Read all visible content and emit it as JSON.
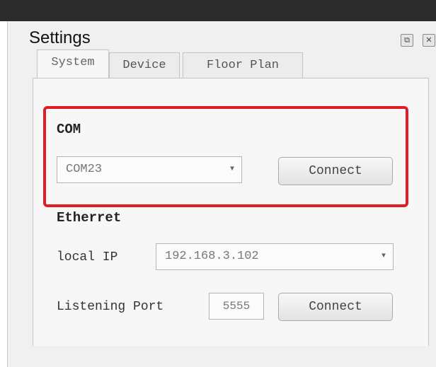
{
  "window": {
    "title": "Settings",
    "float_icon": "float-icon",
    "close_icon": "close-icon"
  },
  "tabs": [
    {
      "label": "System",
      "active": true
    },
    {
      "label": "Device",
      "active": false
    },
    {
      "label": "Floor Plan",
      "active": false
    }
  ],
  "com": {
    "section_label": "COM",
    "port_selected": "COM23",
    "connect_label": "Connect"
  },
  "ethernet": {
    "section_label": "Etherret",
    "local_ip_label": "local IP",
    "local_ip_value": "192.168.3.102",
    "listening_port_label": "Listening Port",
    "listening_port_value": "5555",
    "connect_label": "Connect"
  },
  "colors": {
    "highlight": "#e01c24",
    "titlebar": "#2b2b2b"
  }
}
